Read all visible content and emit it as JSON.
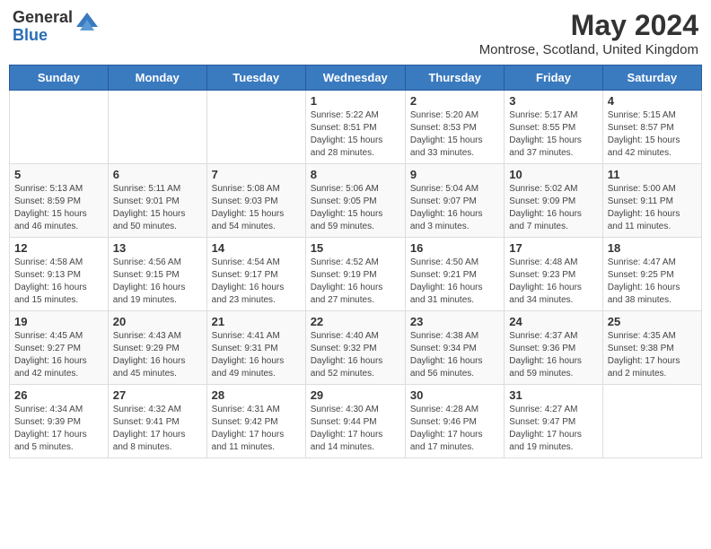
{
  "header": {
    "logo_general": "General",
    "logo_blue": "Blue",
    "month_year": "May 2024",
    "location": "Montrose, Scotland, United Kingdom"
  },
  "days_of_week": [
    "Sunday",
    "Monday",
    "Tuesday",
    "Wednesday",
    "Thursday",
    "Friday",
    "Saturday"
  ],
  "weeks": [
    [
      {
        "day": "",
        "info": ""
      },
      {
        "day": "",
        "info": ""
      },
      {
        "day": "",
        "info": ""
      },
      {
        "day": "1",
        "info": "Sunrise: 5:22 AM\nSunset: 8:51 PM\nDaylight: 15 hours\nand 28 minutes."
      },
      {
        "day": "2",
        "info": "Sunrise: 5:20 AM\nSunset: 8:53 PM\nDaylight: 15 hours\nand 33 minutes."
      },
      {
        "day": "3",
        "info": "Sunrise: 5:17 AM\nSunset: 8:55 PM\nDaylight: 15 hours\nand 37 minutes."
      },
      {
        "day": "4",
        "info": "Sunrise: 5:15 AM\nSunset: 8:57 PM\nDaylight: 15 hours\nand 42 minutes."
      }
    ],
    [
      {
        "day": "5",
        "info": "Sunrise: 5:13 AM\nSunset: 8:59 PM\nDaylight: 15 hours\nand 46 minutes."
      },
      {
        "day": "6",
        "info": "Sunrise: 5:11 AM\nSunset: 9:01 PM\nDaylight: 15 hours\nand 50 minutes."
      },
      {
        "day": "7",
        "info": "Sunrise: 5:08 AM\nSunset: 9:03 PM\nDaylight: 15 hours\nand 54 minutes."
      },
      {
        "day": "8",
        "info": "Sunrise: 5:06 AM\nSunset: 9:05 PM\nDaylight: 15 hours\nand 59 minutes."
      },
      {
        "day": "9",
        "info": "Sunrise: 5:04 AM\nSunset: 9:07 PM\nDaylight: 16 hours\nand 3 minutes."
      },
      {
        "day": "10",
        "info": "Sunrise: 5:02 AM\nSunset: 9:09 PM\nDaylight: 16 hours\nand 7 minutes."
      },
      {
        "day": "11",
        "info": "Sunrise: 5:00 AM\nSunset: 9:11 PM\nDaylight: 16 hours\nand 11 minutes."
      }
    ],
    [
      {
        "day": "12",
        "info": "Sunrise: 4:58 AM\nSunset: 9:13 PM\nDaylight: 16 hours\nand 15 minutes."
      },
      {
        "day": "13",
        "info": "Sunrise: 4:56 AM\nSunset: 9:15 PM\nDaylight: 16 hours\nand 19 minutes."
      },
      {
        "day": "14",
        "info": "Sunrise: 4:54 AM\nSunset: 9:17 PM\nDaylight: 16 hours\nand 23 minutes."
      },
      {
        "day": "15",
        "info": "Sunrise: 4:52 AM\nSunset: 9:19 PM\nDaylight: 16 hours\nand 27 minutes."
      },
      {
        "day": "16",
        "info": "Sunrise: 4:50 AM\nSunset: 9:21 PM\nDaylight: 16 hours\nand 31 minutes."
      },
      {
        "day": "17",
        "info": "Sunrise: 4:48 AM\nSunset: 9:23 PM\nDaylight: 16 hours\nand 34 minutes."
      },
      {
        "day": "18",
        "info": "Sunrise: 4:47 AM\nSunset: 9:25 PM\nDaylight: 16 hours\nand 38 minutes."
      }
    ],
    [
      {
        "day": "19",
        "info": "Sunrise: 4:45 AM\nSunset: 9:27 PM\nDaylight: 16 hours\nand 42 minutes."
      },
      {
        "day": "20",
        "info": "Sunrise: 4:43 AM\nSunset: 9:29 PM\nDaylight: 16 hours\nand 45 minutes."
      },
      {
        "day": "21",
        "info": "Sunrise: 4:41 AM\nSunset: 9:31 PM\nDaylight: 16 hours\nand 49 minutes."
      },
      {
        "day": "22",
        "info": "Sunrise: 4:40 AM\nSunset: 9:32 PM\nDaylight: 16 hours\nand 52 minutes."
      },
      {
        "day": "23",
        "info": "Sunrise: 4:38 AM\nSunset: 9:34 PM\nDaylight: 16 hours\nand 56 minutes."
      },
      {
        "day": "24",
        "info": "Sunrise: 4:37 AM\nSunset: 9:36 PM\nDaylight: 16 hours\nand 59 minutes."
      },
      {
        "day": "25",
        "info": "Sunrise: 4:35 AM\nSunset: 9:38 PM\nDaylight: 17 hours\nand 2 minutes."
      }
    ],
    [
      {
        "day": "26",
        "info": "Sunrise: 4:34 AM\nSunset: 9:39 PM\nDaylight: 17 hours\nand 5 minutes."
      },
      {
        "day": "27",
        "info": "Sunrise: 4:32 AM\nSunset: 9:41 PM\nDaylight: 17 hours\nand 8 minutes."
      },
      {
        "day": "28",
        "info": "Sunrise: 4:31 AM\nSunset: 9:42 PM\nDaylight: 17 hours\nand 11 minutes."
      },
      {
        "day": "29",
        "info": "Sunrise: 4:30 AM\nSunset: 9:44 PM\nDaylight: 17 hours\nand 14 minutes."
      },
      {
        "day": "30",
        "info": "Sunrise: 4:28 AM\nSunset: 9:46 PM\nDaylight: 17 hours\nand 17 minutes."
      },
      {
        "day": "31",
        "info": "Sunrise: 4:27 AM\nSunset: 9:47 PM\nDaylight: 17 hours\nand 19 minutes."
      },
      {
        "day": "",
        "info": ""
      }
    ]
  ]
}
